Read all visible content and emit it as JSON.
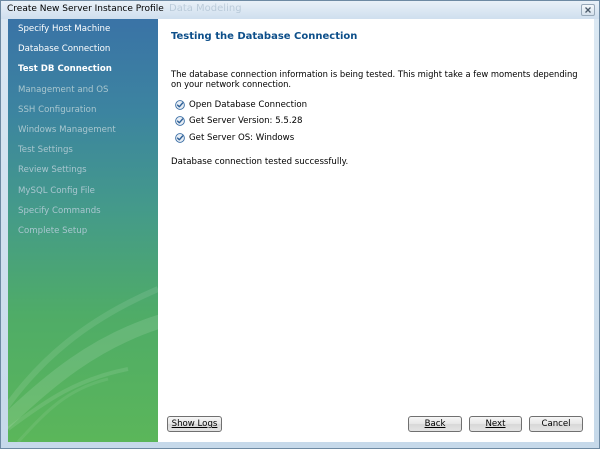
{
  "window": {
    "title": "Create New Server Instance Profile",
    "ghost_title": "Data Modeling"
  },
  "sidebar": {
    "items": [
      {
        "label": "Specify Host Machine",
        "state": "done"
      },
      {
        "label": "Database Connection",
        "state": "done"
      },
      {
        "label": "Test DB Connection",
        "state": "current"
      },
      {
        "label": "Management and OS",
        "state": "future"
      },
      {
        "label": "SSH Configuration",
        "state": "future"
      },
      {
        "label": "Windows Management",
        "state": "future"
      },
      {
        "label": "Test Settings",
        "state": "future"
      },
      {
        "label": "Review Settings",
        "state": "future"
      },
      {
        "label": "MySQL Config File",
        "state": "future"
      },
      {
        "label": "Specify Commands",
        "state": "future"
      },
      {
        "label": "Complete Setup",
        "state": "future"
      }
    ]
  },
  "main": {
    "heading": "Testing the Database Connection",
    "description": "The database connection information is being tested. This might take a few moments depending on your network connection.",
    "checks": [
      {
        "label": "Open Database Connection",
        "checked": true
      },
      {
        "label": "Get Server Version: 5.5.28",
        "checked": true
      },
      {
        "label": "Get Server OS: Windows",
        "checked": true
      }
    ],
    "status": "Database connection tested successfully."
  },
  "buttons": {
    "show_logs": "Show Logs",
    "back": "Back",
    "next": "Next",
    "cancel": "Cancel"
  },
  "colors": {
    "heading": "#0d4f8a",
    "check_icon": "#3a6ea5",
    "sidebar_top": "#3a73a6",
    "sidebar_bottom": "#5bb65a"
  }
}
